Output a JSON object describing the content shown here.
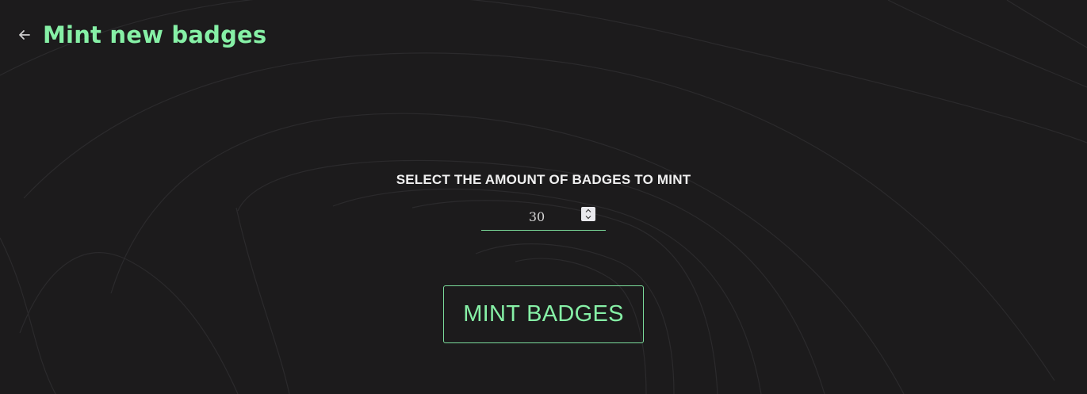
{
  "colors": {
    "background": "#1c1b1c",
    "accent": "#86f0a6",
    "label_text": "#f0f0f0",
    "input_text": "#d4d4d4",
    "back_arrow": "#cfcfcf"
  },
  "header": {
    "back_icon": "arrow-left-icon",
    "title": "Mint new badges"
  },
  "form": {
    "amount_label": "SELECT THE AMOUNT OF BADGES TO MINT",
    "amount_value": "30",
    "stepper_up_icon": "chevron-up-icon",
    "stepper_down_icon": "chevron-down-icon"
  },
  "actions": {
    "mint_label": "MINT BADGES"
  }
}
